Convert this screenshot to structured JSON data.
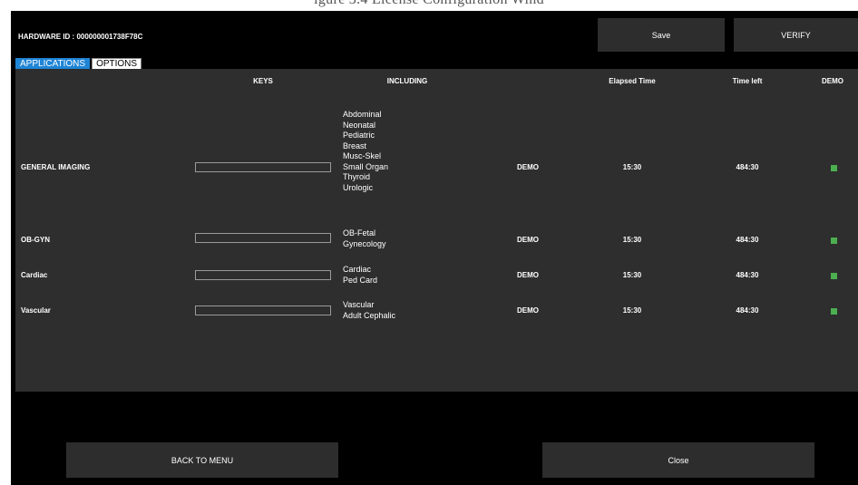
{
  "caption": "igure 3.4 License Configuration Wind",
  "header": {
    "hardware_id": "HARDWARE ID : 000000001738F78C",
    "save_label": "Save",
    "verify_label": "VERIFY"
  },
  "tabs": [
    {
      "label": "APPLICATIONS",
      "active": true
    },
    {
      "label": "OPTIONS",
      "active": false
    }
  ],
  "table": {
    "columns": {
      "keys": "KEYS",
      "including": "INCLUDING",
      "elapsed": "Elapsed Time",
      "time_left": "Time left",
      "demo": "DEMO"
    },
    "rows": [
      {
        "name": "GENERAL IMAGING",
        "key_value": "",
        "including": [
          "Abdominal",
          "Neonatal",
          "Pediatric",
          "Breast",
          "Musc-Skel",
          "Small Organ",
          "Thyroid",
          "Urologic"
        ],
        "status": "DEMO",
        "elapsed": "15:30",
        "time_left": "484:30",
        "demo_enabled": true
      },
      {
        "name": "OB-GYN",
        "key_value": "",
        "including": [
          "OB-Fetal",
          "Gynecology"
        ],
        "status": "DEMO",
        "elapsed": "15:30",
        "time_left": "484:30",
        "demo_enabled": true
      },
      {
        "name": "Cardiac",
        "key_value": "",
        "including": [
          "Cardiac",
          "Ped Card"
        ],
        "status": "DEMO",
        "elapsed": "15:30",
        "time_left": "484:30",
        "demo_enabled": true
      },
      {
        "name": "Vascular",
        "key_value": "",
        "including": [
          "Vascular",
          "Adult Cephalic"
        ],
        "status": "DEMO",
        "elapsed": "15:30",
        "time_left": "484:30",
        "demo_enabled": true
      }
    ]
  },
  "footer": {
    "back_label": "BACK TO MENU",
    "close_label": "Close"
  },
  "colors": {
    "background": "#000000",
    "panel": "#2e2e2e",
    "button": "#2d2d2d",
    "tab_active": "#1f85d6",
    "demo_indicator": "#4caf50"
  }
}
